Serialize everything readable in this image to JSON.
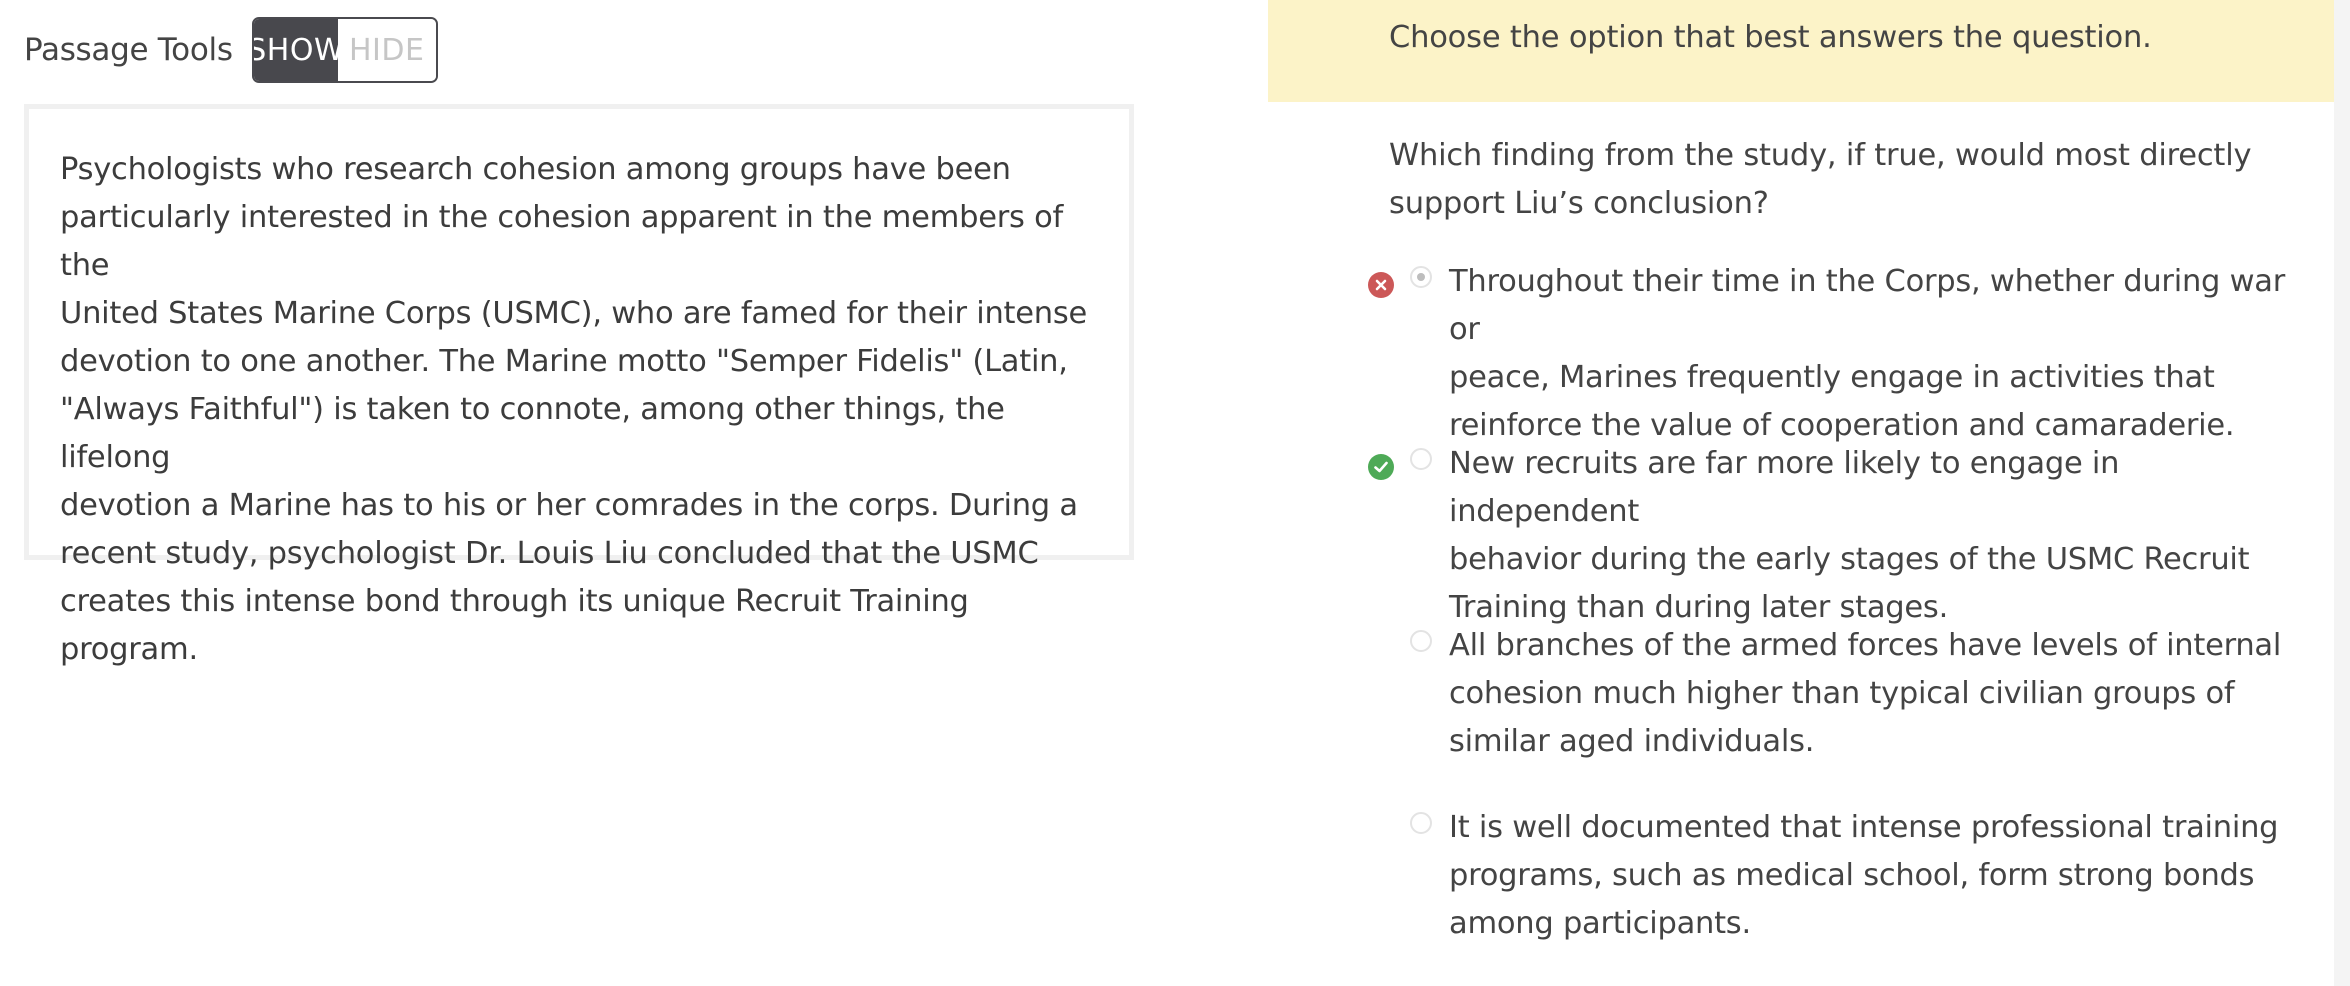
{
  "passage_tools": {
    "label": "Passage Tools",
    "show_label": "SHOW",
    "hide_label": "HIDE",
    "active": "SHOW"
  },
  "passage": {
    "lines": [
      "Psychologists who research cohesion among groups have been",
      "particularly interested in the cohesion apparent in the members of the",
      "United States Marine Corps (USMC), who are famed for their intense",
      "devotion to one another. The Marine motto \"Semper Fidelis\" (Latin,",
      "\"Always Faithful\") is taken to connote, among other things, the lifelong",
      "devotion a Marine has to his or her comrades in the corps. During a",
      "recent study, psychologist Dr. Louis Liu concluded that the USMC",
      "creates this intense bond through its unique Recruit Training program."
    ]
  },
  "instruction": "Choose the option that best answers the question.",
  "question": {
    "lines": [
      "Which finding from the study, if true, would most directly",
      "support Liu’s conclusion?"
    ]
  },
  "choices": [
    {
      "lines": [
        "Throughout their time in the Corps, whether during war or",
        "peace, Marines frequently engage in activities that",
        "reinforce the value of cooperation and camaraderie."
      ],
      "selected": true,
      "result": "incorrect",
      "result_icon": "x-icon"
    },
    {
      "lines": [
        "New recruits are far more likely to engage in independent",
        "behavior during the early stages of the USMC Recruit",
        "Training than during later stages."
      ],
      "selected": false,
      "result": "correct",
      "result_icon": "check-icon"
    },
    {
      "lines": [
        "All branches of the armed forces have levels of internal",
        "cohesion much higher than typical civilian groups of",
        "similar aged individuals."
      ],
      "selected": false,
      "result": "none"
    },
    {
      "lines": [
        "It is well documented that intense professional training",
        "programs, such as medical school, form strong bonds",
        "among participants."
      ],
      "selected": false,
      "result": "none"
    }
  ],
  "colors": {
    "instruction_bg": "#fcf3c8",
    "incorrect": "#cc5858",
    "correct": "#4eaa57",
    "toggle_active_bg": "#48484d"
  }
}
